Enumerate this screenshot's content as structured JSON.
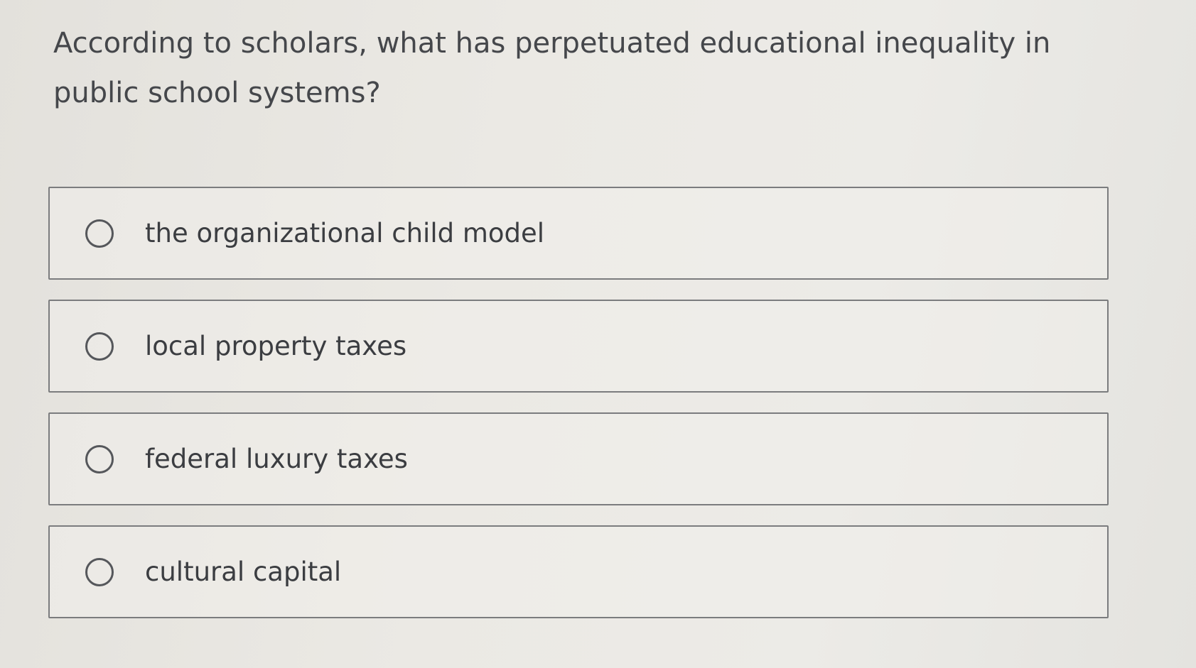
{
  "question": {
    "text": "According to scholars, what has perpetuated educational inequality in public school systems?"
  },
  "options": [
    {
      "label": "the organizational child model",
      "selected": false
    },
    {
      "label": "local property taxes",
      "selected": false
    },
    {
      "label": "federal luxury taxes",
      "selected": false
    },
    {
      "label": "cultural capital",
      "selected": false
    }
  ]
}
